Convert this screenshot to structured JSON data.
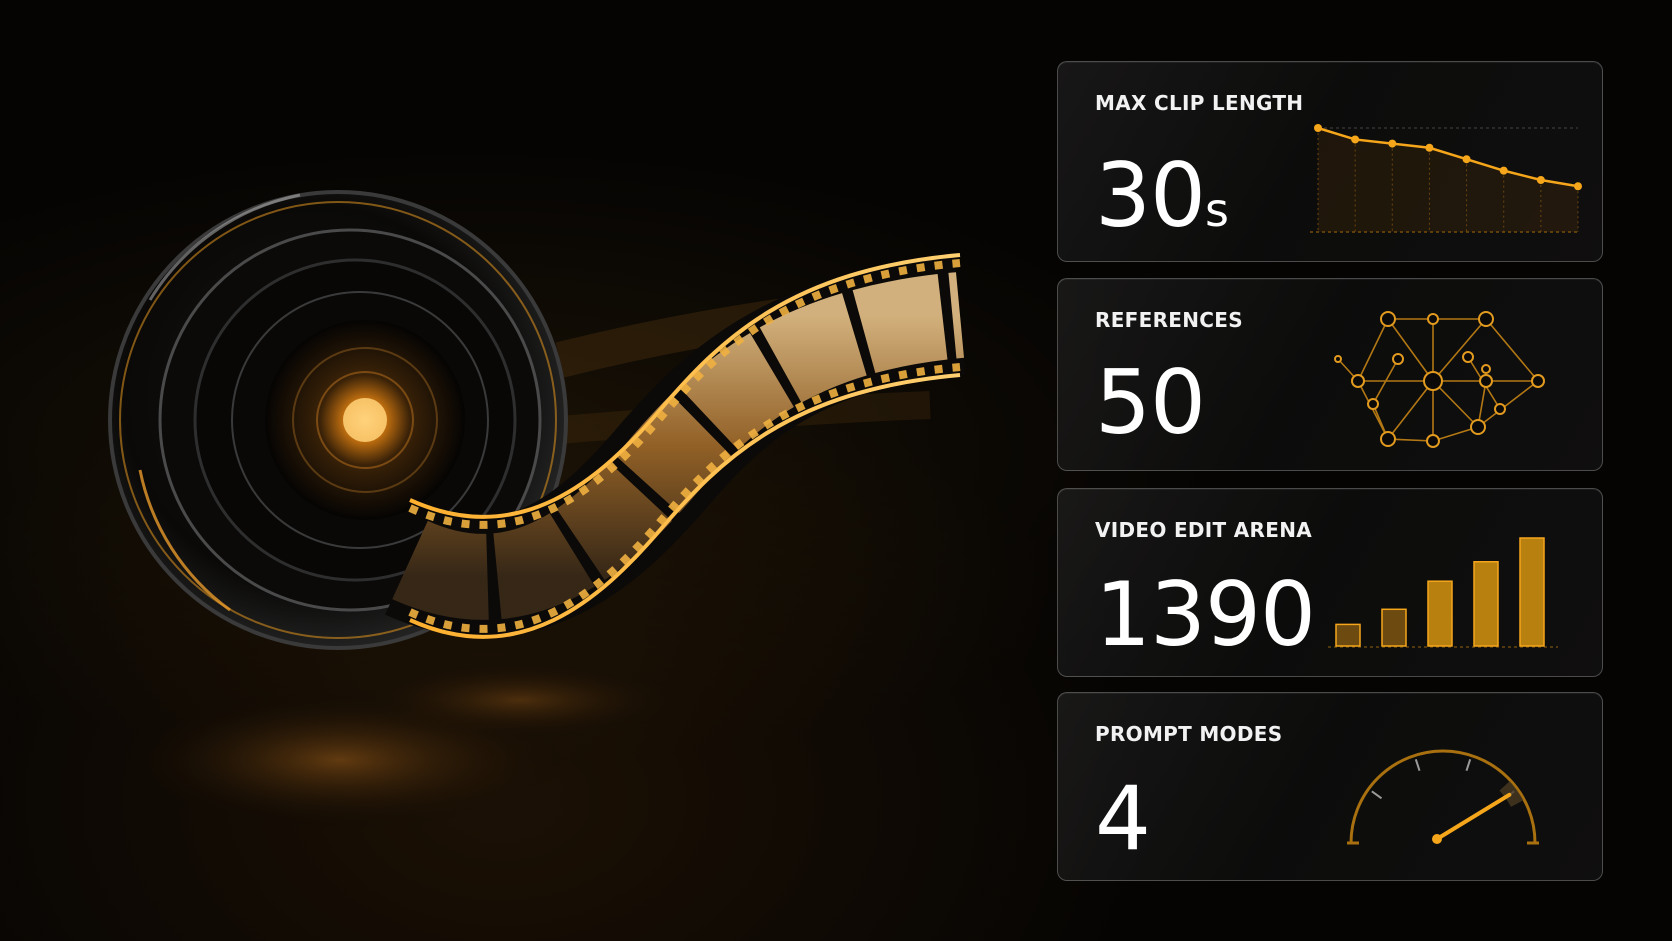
{
  "colors": {
    "accent": "#f5a61b",
    "accent_dim": "#8a5a0c",
    "panel_border": "#8f8f8f",
    "background": "#050403"
  },
  "hero": {
    "image": "camera-lens-with-film-strip"
  },
  "stats": [
    {
      "label": "MAX CLIP LENGTH",
      "value": "30",
      "unit": "s",
      "visual": "declining-line-chart-icon",
      "trend_points": [
        10,
        8.9,
        8.5,
        8.1,
        7.0,
        5.9,
        5.0,
        4.4
      ]
    },
    {
      "label": "REFERENCES",
      "value": "50",
      "visual": "network-graph-icon"
    },
    {
      "label": "VIDEO EDIT ARENA",
      "value": "1390",
      "visual": "bar-chart-icon",
      "bar_levels": [
        0.2,
        0.34,
        0.6,
        0.78,
        1.0
      ]
    },
    {
      "label": "PROMPT MODES",
      "value": "4",
      "visual": "gauge-icon",
      "gauge_level": 0.8
    }
  ]
}
